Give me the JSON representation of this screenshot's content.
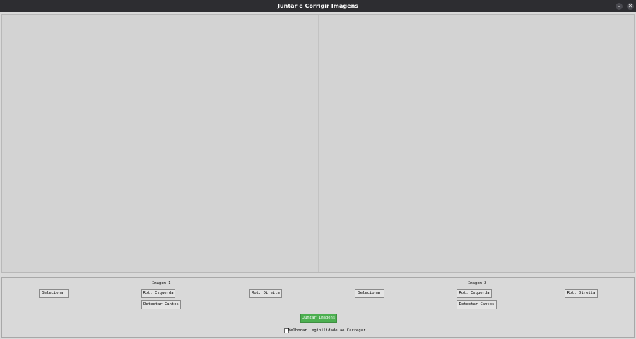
{
  "window": {
    "title": "Juntar e Corrigir Imagens",
    "minimize_glyph": "–",
    "close_glyph": "✕"
  },
  "image1": {
    "label": "Imagem 1",
    "select": "Selecionar",
    "rotate_left": "Rot. Esquerda",
    "rotate_right": "Rot. Direita",
    "detect_corners": "Detectar Cantos"
  },
  "image2": {
    "label": "Imagem 2",
    "select": "Selecionar",
    "rotate_left": "Rot. Esquerda",
    "rotate_right": "Rot. Direita",
    "detect_corners": "Detectar Cantos"
  },
  "join_button": "Juntar Imagens",
  "legibility": {
    "label": "Melhorar Legibilidade ao Carregar",
    "checked": false
  },
  "colors": {
    "primary_button": "#4caf50",
    "titlebar": "#2d2d31"
  }
}
